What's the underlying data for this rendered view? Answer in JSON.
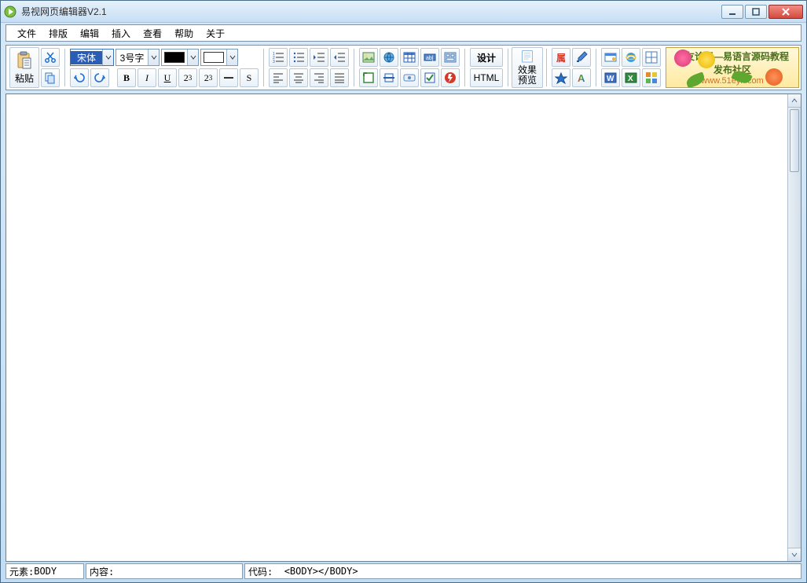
{
  "app": {
    "title": "易视网页编辑器V2.1"
  },
  "menu": {
    "items": [
      "文件",
      "排版",
      "编辑",
      "插入",
      "查看",
      "帮助",
      "关于"
    ]
  },
  "toolbar": {
    "paste_label": "粘贴",
    "font_selector": "宋体",
    "size_selector": "3号字",
    "design_label": "设计",
    "html_label": "HTML",
    "preview_label_line1": "效果",
    "preview_label_line2": "预览",
    "attr_label": "属"
  },
  "banner": {
    "text": "易友论坛—易语言源码教程发布社区",
    "url": "www.51eyk.com"
  },
  "status": {
    "element_label": "元素:",
    "element_value": "BODY",
    "content_label": "内容:",
    "code_label": "代码:",
    "code_value": "<BODY></BODY>"
  }
}
